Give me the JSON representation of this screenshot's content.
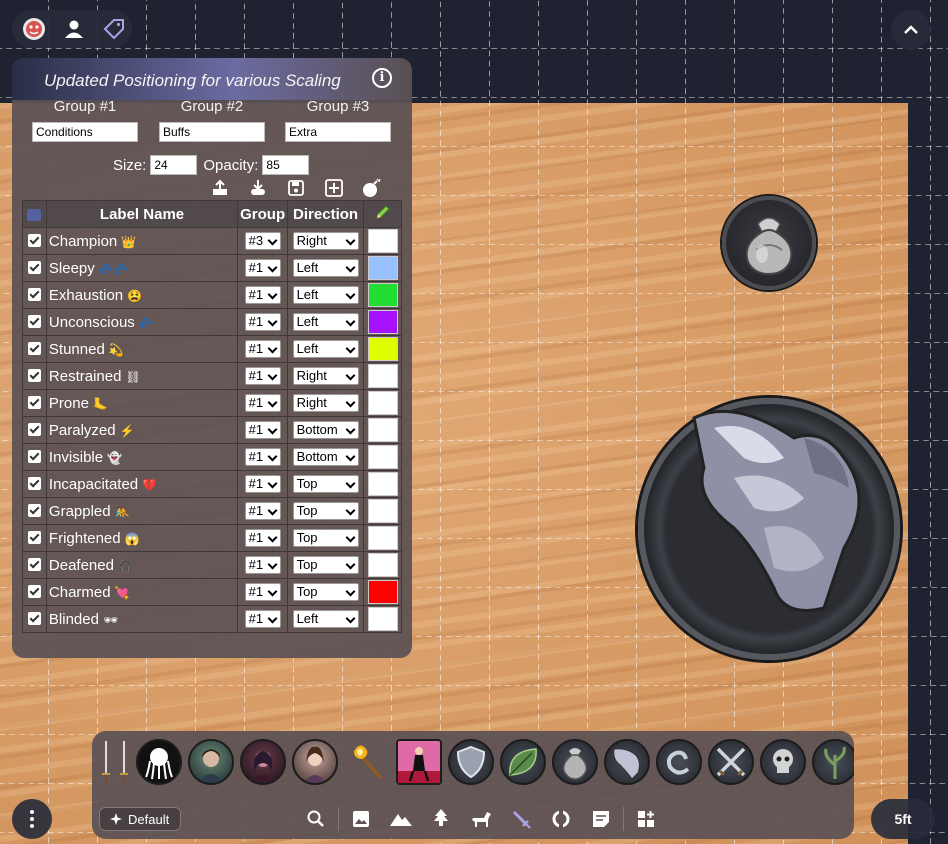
{
  "panel": {
    "title": "Updated Positioning for various Scaling",
    "groups": [
      {
        "label": "Group #1",
        "value": "Conditions"
      },
      {
        "label": "Group #2",
        "value": "Buffs"
      },
      {
        "label": "Group #3",
        "value": "Extra"
      }
    ],
    "size_label": "Size:",
    "size_value": "24",
    "opacity_label": "Opacity:",
    "opacity_value": "85",
    "table_headers": {
      "name": "Label Name",
      "group": "Group",
      "direction": "Direction"
    },
    "rows": [
      {
        "name": "Champion",
        "emoji": "👑",
        "group": "#3",
        "direction": "Right",
        "color": "#ffffff"
      },
      {
        "name": "Sleepy",
        "emoji": "💤💤",
        "group": "#1",
        "direction": "Left",
        "color": "#99c1ff"
      },
      {
        "name": "Exhaustion",
        "emoji": "😫",
        "group": "#1",
        "direction": "Left",
        "color": "#22dd33"
      },
      {
        "name": "Unconscious",
        "emoji": "💤",
        "group": "#1",
        "direction": "Left",
        "color": "#a611ff"
      },
      {
        "name": "Stunned",
        "emoji": "💫",
        "group": "#1",
        "direction": "Left",
        "color": "#ddff00"
      },
      {
        "name": "Restrained",
        "emoji": "⛓",
        "group": "#1",
        "direction": "Right",
        "color": "#ffffff"
      },
      {
        "name": "Prone",
        "emoji": "🦶",
        "group": "#1",
        "direction": "Right",
        "color": "#ffffff"
      },
      {
        "name": "Paralyzed",
        "emoji": "⚡",
        "group": "#1",
        "direction": "Bottom",
        "color": "#ffffff"
      },
      {
        "name": "Invisible",
        "emoji": "👻",
        "group": "#1",
        "direction": "Bottom",
        "color": "#ffffff"
      },
      {
        "name": "Incapacitated",
        "emoji": "💔",
        "group": "#1",
        "direction": "Top",
        "color": "#ffffff"
      },
      {
        "name": "Grappled",
        "emoji": "🤼",
        "group": "#1",
        "direction": "Top",
        "color": "#ffffff"
      },
      {
        "name": "Frightened",
        "emoji": "😱",
        "group": "#1",
        "direction": "Top",
        "color": "#ffffff"
      },
      {
        "name": "Deafened",
        "emoji": "🎧",
        "group": "#1",
        "direction": "Top",
        "color": "#ffffff"
      },
      {
        "name": "Charmed",
        "emoji": "💘",
        "group": "#1",
        "direction": "Top",
        "color": "#ff0000"
      },
      {
        "name": "Blinded",
        "emoji": "🕶",
        "group": "#1",
        "direction": "Left",
        "color": "#ffffff"
      }
    ]
  },
  "bottom": {
    "default_label": "Default",
    "scale_label": "5ft"
  },
  "colors": {
    "panel_bg": "#5c5254",
    "map_bg": "#1f2331",
    "sand": "#d69a64"
  },
  "icons": {
    "top_toolbar": [
      "dice-icon",
      "user-icon",
      "tag-icon"
    ],
    "actions": [
      "upload-icon",
      "download-icon",
      "save-icon",
      "add-icon",
      "bomb-icon"
    ],
    "layers": [
      "search-icon",
      "image-icon",
      "mountain-icon",
      "tree-icon",
      "horse-icon",
      "sword-icon",
      "circle-icon",
      "note-icon",
      "widgets-icon"
    ]
  }
}
